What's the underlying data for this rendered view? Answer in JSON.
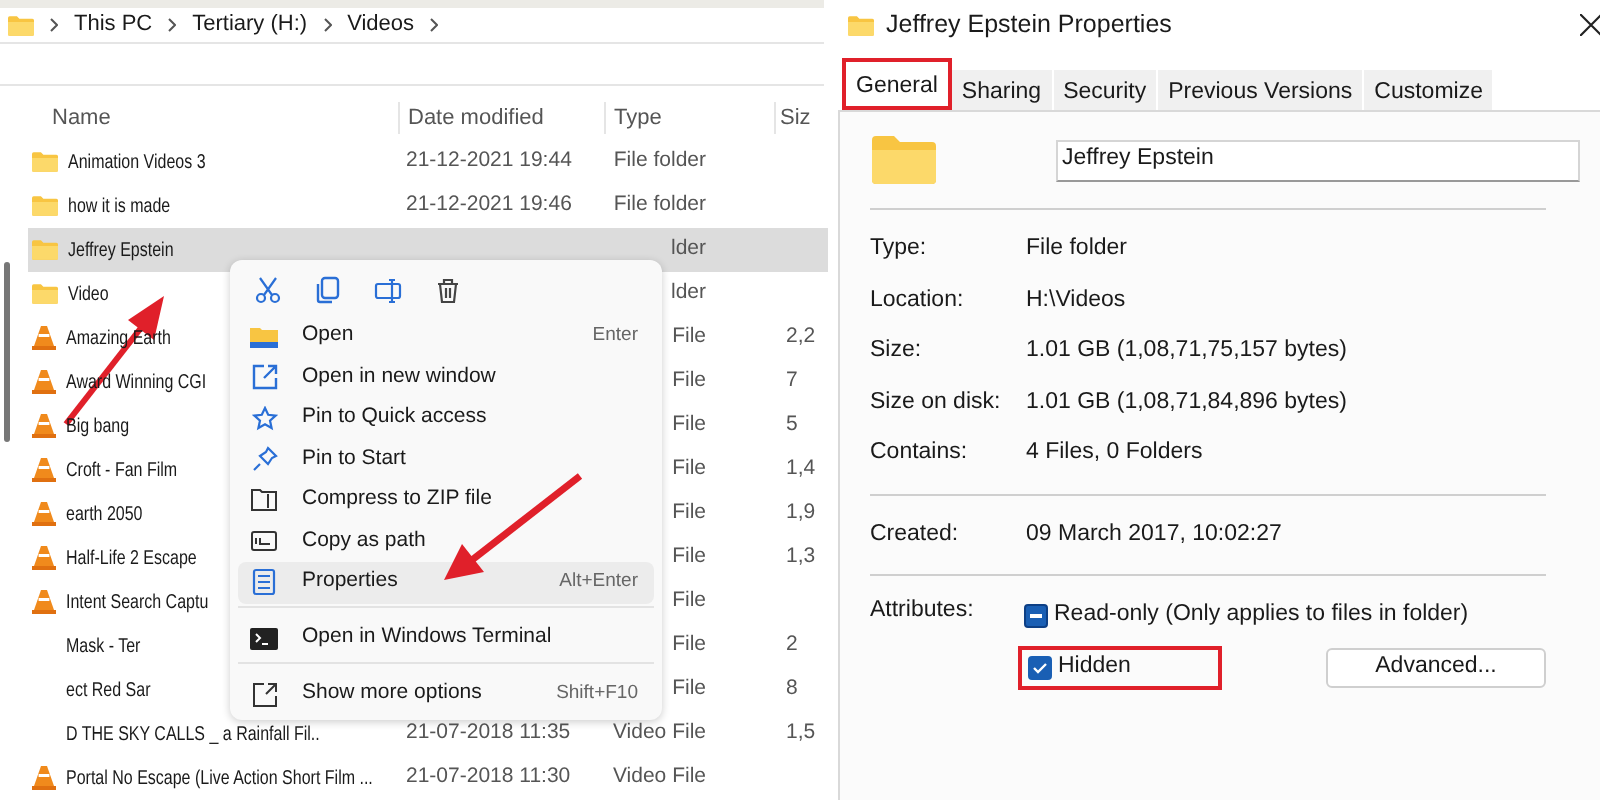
{
  "explorer": {
    "breadcrumb": [
      "This PC",
      "Tertiary (H:)",
      "Videos"
    ],
    "columns": [
      "Name",
      "Date modified",
      "Type",
      "Siz"
    ],
    "rows": [
      {
        "kind": "folder",
        "name": "Animation Videos 3",
        "date": "21-12-2021 19:44",
        "type": "File folder",
        "selected": false
      },
      {
        "kind": "folder",
        "name": "how it is made",
        "date": "21-12-2021 19:46",
        "type": "File folder",
        "selected": false
      },
      {
        "kind": "folder",
        "name": "Jeffrey Epstein",
        "type": "lder",
        "selected": true
      },
      {
        "kind": "folder",
        "name": "Video",
        "type": "lder",
        "selected": false
      },
      {
        "kind": "video",
        "name": "Amazing Earth",
        "type": "File",
        "size": "2,2",
        "selected": false
      },
      {
        "kind": "video",
        "name": "Award Winning CGI",
        "type": "File",
        "size": "7",
        "selected": false
      },
      {
        "kind": "video",
        "name": "Big bang",
        "type": "File",
        "size": "5",
        "selected": false
      },
      {
        "kind": "video",
        "name": "Croft - Fan Film",
        "type": "File",
        "size": "1,4",
        "selected": false
      },
      {
        "kind": "video",
        "name": "earth 2050",
        "type": "File",
        "size": "1,9",
        "selected": false
      },
      {
        "kind": "video",
        "name": "Half-Life 2 Escape",
        "type": "File",
        "size": "1,3",
        "selected": false
      },
      {
        "kind": "video",
        "name": "Intent Search Captu",
        "type": "File",
        "selected": false
      },
      {
        "kind": "text",
        "name": "Mask - Ter",
        "type": "File",
        "size": "2",
        "selected": false
      },
      {
        "kind": "text",
        "name": "ect Red Sar",
        "type": "File",
        "size": "8",
        "selected": false
      },
      {
        "kind": "text",
        "name": "D THE SKY CALLS _ a Rainfall Fil..",
        "date": "21-07-2018 11:35",
        "type": "Video File",
        "size": "1,5",
        "selected": false
      },
      {
        "kind": "video",
        "name": "Portal No Escape (Live Action Short Film ...",
        "date": "21-07-2018 11:30",
        "type": "Video File",
        "selected": false
      }
    ],
    "context_menu": {
      "items": [
        {
          "label": "Open",
          "shortcut": "Enter",
          "divider_before": false,
          "selected": false
        },
        {
          "label": "Open in new window",
          "divider_before": false,
          "selected": false
        },
        {
          "label": "Pin to Quick access",
          "divider_before": false,
          "selected": false
        },
        {
          "label": "Pin to Start",
          "divider_before": false,
          "selected": false
        },
        {
          "label": "Compress to ZIP file",
          "divider_before": false,
          "selected": false
        },
        {
          "label": "Copy as path",
          "divider_before": false,
          "selected": false
        },
        {
          "label": "Properties",
          "shortcut": "Alt+Enter",
          "divider_before": false,
          "selected": true
        },
        {
          "label": "Open in Windows Terminal",
          "divider_before": true,
          "selected": false
        },
        {
          "label": "Show more options",
          "shortcut": "Shift+F10",
          "divider_before": true,
          "selected": false
        }
      ]
    }
  },
  "properties_dialog": {
    "title": "Jeffrey Epstein Properties",
    "tabs": [
      {
        "label": "General",
        "selected": true,
        "annotated": true
      },
      {
        "label": "Sharing",
        "selected": false,
        "annotated": false
      },
      {
        "label": "Security",
        "selected": false,
        "annotated": false
      },
      {
        "label": "Previous Versions",
        "selected": false,
        "annotated": false
      },
      {
        "label": "Customize",
        "selected": false,
        "annotated": false
      }
    ],
    "name_field": {
      "value": "Jeffrey Epstein"
    },
    "sections": [
      [
        {
          "label": "Type:",
          "value": "File folder"
        },
        {
          "label": "Location:",
          "value": "H:\\Videos"
        },
        {
          "label": "Size:",
          "value": "1.01 GB (1,08,71,75,157 bytes)"
        },
        {
          "label": "Size on disk:",
          "value": "1.01 GB (1,08,71,84,896 bytes)"
        },
        {
          "label": "Contains:",
          "value": "4 Files, 0 Folders"
        }
      ],
      [
        {
          "label": "Created:",
          "value": "09 March 2017, 10:02:27"
        }
      ]
    ],
    "attributes_label": "Attributes:",
    "attributes": [
      {
        "label": "Read-only (Only applies to files in folder)",
        "checked": false,
        "indeterminate": true,
        "annotated": false
      },
      {
        "label": "Hidden",
        "checked": true,
        "indeterminate": false,
        "annotated": true
      }
    ],
    "advanced_button": "Advanced..."
  }
}
